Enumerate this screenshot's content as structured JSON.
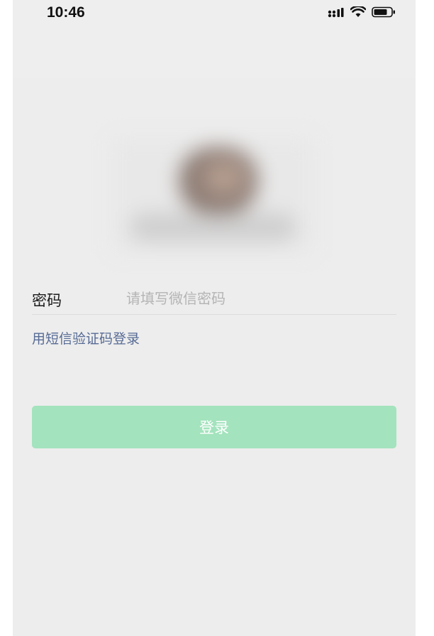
{
  "status_bar": {
    "time": "10:46",
    "icons": [
      "signal-icon",
      "wifi-icon",
      "battery-icon"
    ]
  },
  "avatar": {
    "icon": "avatar"
  },
  "login_form": {
    "password_label": "密码",
    "password_placeholder": "请填写微信密码",
    "password_value": "",
    "sms_login_link": "用短信验证码登录",
    "login_button_label": "登录"
  },
  "colors": {
    "background": "#ededed",
    "link": "#576b95",
    "button_disabled": "#a3e3bd",
    "button_text": "#ffffff"
  }
}
